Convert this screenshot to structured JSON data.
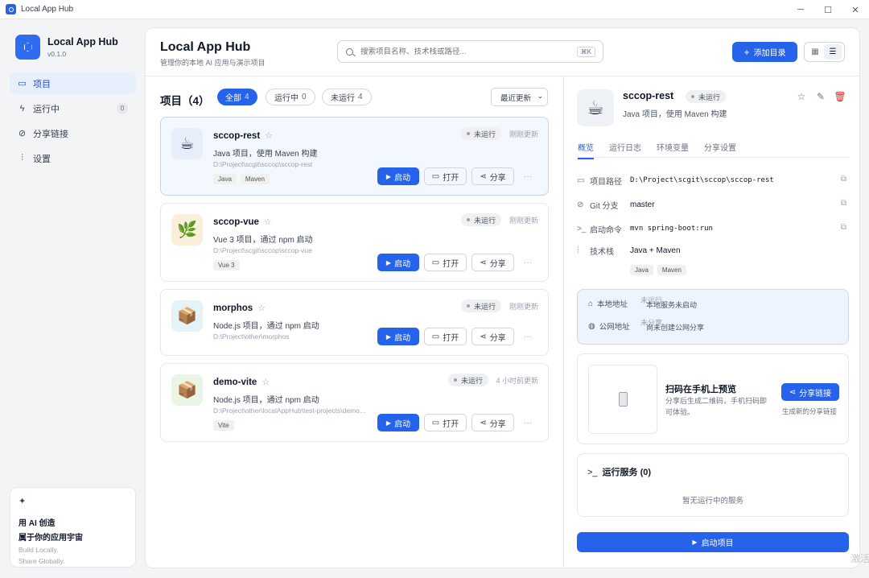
{
  "window": {
    "title": "Local App Hub",
    "min": "─",
    "max": "☐",
    "close": "✕"
  },
  "sidebar": {
    "brand_name": "Local App Hub",
    "version": "v0.1.0",
    "items": [
      {
        "label": "项目",
        "icon": "folder-icon",
        "glyph": "▭"
      },
      {
        "label": "运行中",
        "icon": "bolt-icon",
        "glyph": "ϟ",
        "count": "0"
      },
      {
        "label": "分享链接",
        "icon": "link-icon",
        "glyph": "⊘"
      },
      {
        "label": "设置",
        "icon": "sliders-icon",
        "glyph": "⫶"
      }
    ],
    "promo": {
      "line1": "用 AI 创造",
      "line2": "属于你的应用宇宙",
      "line3": "Build Locally.",
      "line4": "Share Globally."
    }
  },
  "header": {
    "title": "Local App Hub",
    "subtitle": "管理你的本地 AI 应用与演示项目",
    "search_placeholder": "搜索项目名称、技术栈或路径...",
    "shortcut": "⌘K",
    "add_label": "添加目录"
  },
  "list": {
    "title": "项目（4）",
    "filters": [
      {
        "label": "全部",
        "count": "4"
      },
      {
        "label": "运行中",
        "count": "0"
      },
      {
        "label": "未运行",
        "count": "4"
      }
    ],
    "sort": "最近更新",
    "actions": {
      "start": "启动",
      "open": "打开",
      "share": "分享"
    },
    "projects": [
      {
        "name": "sccop-rest",
        "desc": "Java 项目，使用 Maven 构建",
        "path": "D:\\Project\\scgit\\sccop\\sccop-rest",
        "tags": [
          "Java",
          "Maven"
        ],
        "status": "未运行",
        "updated": "刚刚更新",
        "emoji": "☕",
        "bg": "#e7eef9"
      },
      {
        "name": "sccop-vue",
        "desc": "Vue 3 项目，通过 npm 启动",
        "path": "D:\\Project\\scgit\\sccop\\sccop-vue",
        "tags": [
          "Vue 3"
        ],
        "status": "未运行",
        "updated": "刚刚更新",
        "emoji": "🌿",
        "bg": "#fbefdc"
      },
      {
        "name": "morphos",
        "desc": "Node.js 项目，通过 npm 启动",
        "path": "D:\\Project\\other\\morphos",
        "tags": [],
        "status": "未运行",
        "updated": "刚刚更新",
        "emoji": "📦",
        "bg": "#e3f3f8"
      },
      {
        "name": "demo-vite",
        "desc": "Node.js 项目，通过 npm 启动",
        "path": "D:\\Project\\other\\localAppHub\\test-projects\\demo-vite",
        "tags": [
          "Vite"
        ],
        "status": "未运行",
        "updated": "4 小时前更新",
        "emoji": "📦",
        "bg": "#eaf5e6"
      }
    ]
  },
  "detail": {
    "name": "sccop-rest",
    "status": "未运行",
    "desc": "Java 项目，使用 Maven 构建",
    "tabs": [
      "概览",
      "运行日志",
      "环境变量",
      "分享设置"
    ],
    "path_label": "项目路径",
    "path": "D:\\Project\\scgit\\sccop\\sccop-rest",
    "git_label": "Git 分支",
    "git": "master",
    "cmd_label": "启动命令",
    "cmd": "mvn spring-boot:run",
    "stack_label": "技术栈",
    "stack": "Java + Maven",
    "tags": [
      "Java",
      "Maven"
    ],
    "local_label": "本地地址",
    "local_ghost": "未运行",
    "local_value": "本地服务未启动",
    "public_label": "公网地址",
    "public_ghost": "未分享",
    "public_value": "尚未创建公网分享",
    "qr_title": "扫码在手机上预览",
    "qr_desc": "分享后生成二维码，手机扫码即可体验。",
    "share_link": "分享链接",
    "share_hint": "生成新的分享链接",
    "running_title": "运行服务 (0)",
    "running_empty": "暂无运行中的服务",
    "start_project": "启动项目"
  },
  "watermark": "激活 转到"
}
